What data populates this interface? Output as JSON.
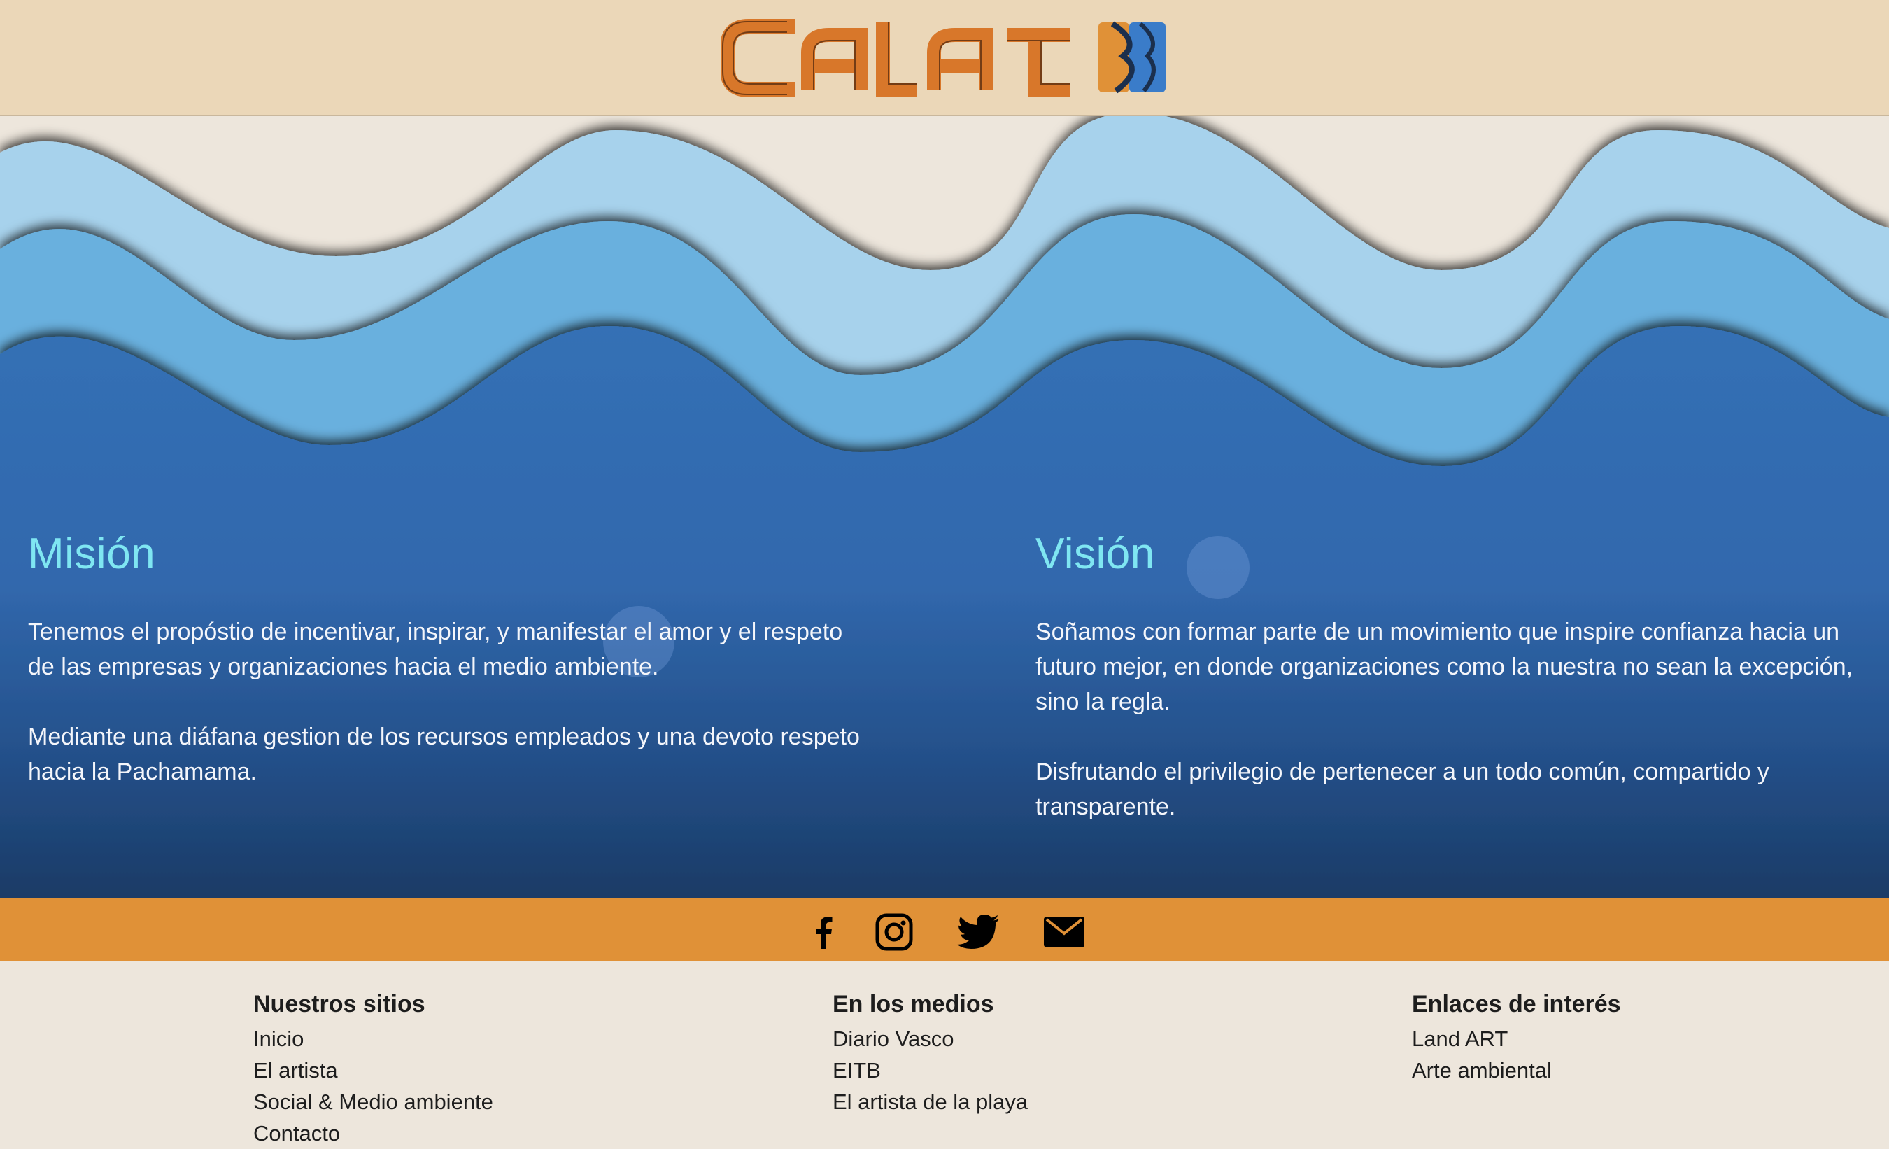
{
  "header": {
    "logo_text": "CALAT"
  },
  "colors": {
    "sand": "#ebd7b8",
    "wave_light": "#a7d2ec",
    "wave_mid": "#69b0de",
    "ocean": "#3470b5",
    "ocean_deep": "#1a3b66",
    "heading_cyan": "#7fe6f2",
    "social_bar": "#e09137",
    "footer_bg": "#ede6dc",
    "logo_orange": "#d8772a"
  },
  "mision": {
    "title": "Misión",
    "p1": "Tenemos el propóstio de incentivar, inspirar, y manifestar el amor y el respeto de las empresas y organizaciones hacia el medio ambiente.",
    "p2": "Mediante una diáfana gestion de los recursos empleados y una devoto respeto hacia la Pachamama."
  },
  "vision": {
    "title": "Visión",
    "p1": "Soñamos con formar parte de un movimiento que inspire confianza hacia un futuro mejor, en donde organizaciones como la nuestra no sean la excepción, sino la regla.",
    "p2": "Disfrutando el privilegio de pertenecer a un todo común, compartido y transparente."
  },
  "social": {
    "icons": [
      "facebook-icon",
      "instagram-icon",
      "twitter-icon",
      "mail-icon"
    ]
  },
  "footer": {
    "col1": {
      "title": "Nuestros sitios",
      "links": [
        "Inicio",
        "El artista",
        "Social & Medio ambiente",
        "Contacto"
      ]
    },
    "col2": {
      "title": "En los medios",
      "links": [
        "Diario Vasco",
        "EITB",
        "El artista de la playa"
      ]
    },
    "col3": {
      "title": "Enlaces de interés",
      "links": [
        "Land ART",
        "Arte ambiental"
      ]
    }
  }
}
